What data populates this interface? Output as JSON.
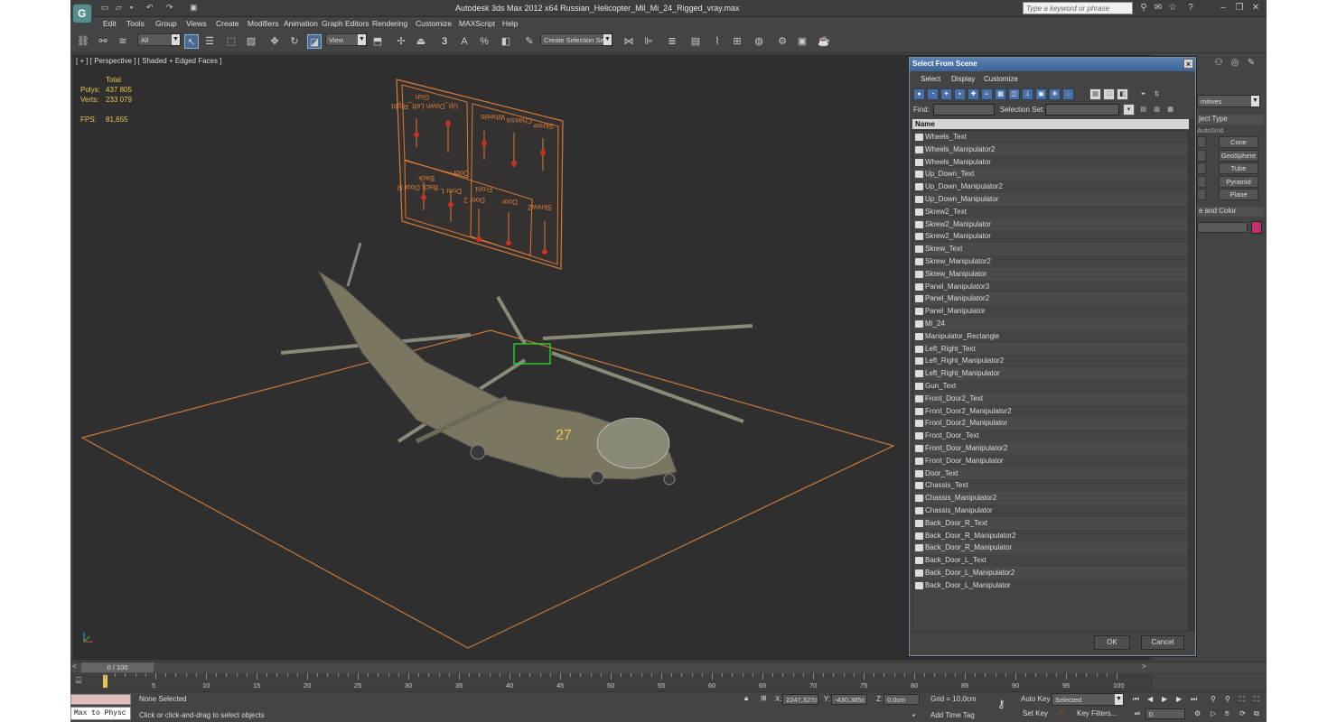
{
  "window": {
    "title": "Autodesk 3ds Max  2012 x64     Russian_Helicopter_Mil_Mi_24_Rigged_vray.max",
    "search_placeholder": "Type a keyword or phrase",
    "logo": "G"
  },
  "menu": [
    "Edit",
    "Tools",
    "Group",
    "Views",
    "Create",
    "Modifiers",
    "Animation",
    "Graph Editors",
    "Rendering",
    "Customize",
    "MAXScript",
    "Help"
  ],
  "toolbar": {
    "filter": "All",
    "refcoord": "View",
    "selection_set": "Create Selection Se",
    "snap": "3",
    "angle": "A",
    "percent": "%"
  },
  "viewport": {
    "label": "[ + ] [ Perspective ] [ Shaded + Edged Faces ]",
    "stats": {
      "total_label": "Total",
      "polys_label": "Polys:",
      "polys": "437 805",
      "verts_label": "Verts:",
      "verts": "233 079",
      "fps_label": "FPS:",
      "fps": "81,655"
    },
    "panel_labels": [
      "Gun",
      "Up_Down Left_Right",
      "Wheels",
      "Chassis",
      "Skrew",
      "Door",
      "Back",
      "Front",
      "Back Door R",
      "Door L",
      "Door 2",
      "Door",
      "Skrew2"
    ],
    "heli_number": "27"
  },
  "command_panel": {
    "dropdown": "mitives",
    "section1": "ject Type",
    "autogrid": "AutoGrid",
    "buttons": [
      "Cone",
      "GeoSphere",
      "Tube",
      "Pyramid",
      "Plane"
    ],
    "section2": "e and Color",
    "swatch_color": "#c0306a"
  },
  "dialog": {
    "title": "Select From Scene",
    "menu": [
      "Select",
      "Display",
      "Customize"
    ],
    "find_label": "Find:",
    "selset_label": "Selection Set:",
    "column": "Name",
    "items": [
      "Wheels_Text",
      "Wheels_Manipulator2",
      "Wheels_Manipulator",
      "Up_Down_Text",
      "Up_Down_Manipulator2",
      "Up_Down_Manipulator",
      "Skrew2_Text",
      "Skrew2_Manipulator",
      "Skrew2_Manipulator",
      "Skrew_Text",
      "Skrew_Manipulator2",
      "Skrew_Manipulator",
      "Panel_Manipulator3",
      "Panel_Manipulator2",
      "Panel_Manipulator",
      "Mi_24",
      "Manipulator_Rectangle",
      "Left_Right_Text",
      "Left_Right_Manipulator2",
      "Left_Right_Manipulator",
      "Gun_Text",
      "Front_Door2_Text",
      "Front_Door2_Manipulator2",
      "Front_Door2_Manipulator",
      "Front_Door_Text",
      "Front_Door_Manipulator2",
      "Front_Door_Manipulator",
      "Door_Text",
      "Chassis_Text",
      "Chassis_Manipulator2",
      "Chassis_Manipulator",
      "Back_Door_R_Text",
      "Back_Door_R_Manipulator2",
      "Back_Door_R_Manipulator",
      "Back_Door_L_Text",
      "Back_Door_L_Manipulator2",
      "Back_Door_L_Manipulator"
    ],
    "ok": "OK",
    "cancel": "Cancel"
  },
  "timeline": {
    "frame": "0 / 100",
    "ticks": [
      "5",
      "10",
      "15",
      "20",
      "25",
      "30",
      "35",
      "40",
      "45",
      "50",
      "55",
      "60",
      "65",
      "70",
      "75",
      "80",
      "85",
      "90",
      "95",
      "100"
    ]
  },
  "status": {
    "maxscript": "Max to Physc",
    "selection": "None Selected",
    "prompt": "Click or click-and-drag to select objects",
    "x_label": "X:",
    "x": "2247,327c",
    "y_label": "Y:",
    "y": "-430,385c",
    "z_label": "Z:",
    "z": "0,0cm",
    "grid": "Grid = 10,0cm",
    "add_time_tag": "Add Time Tag",
    "auto_key": "Auto Key",
    "set_key": "Set Key",
    "key_mode": "Selected",
    "key_filters": "Key Filters...",
    "frame_field": "0"
  }
}
